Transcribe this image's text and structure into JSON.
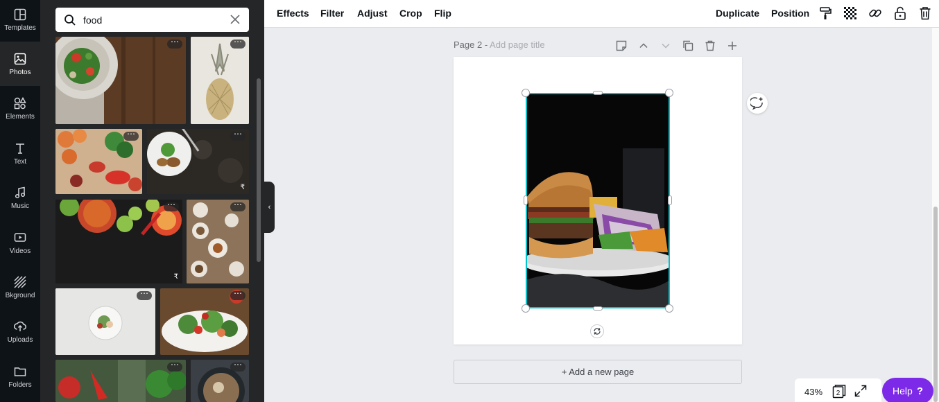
{
  "rail": {
    "items": [
      {
        "label": "Templates",
        "icon": "templates-icon"
      },
      {
        "label": "Photos",
        "icon": "photos-icon",
        "active": true
      },
      {
        "label": "Elements",
        "icon": "elements-icon"
      },
      {
        "label": "Text",
        "icon": "text-icon"
      },
      {
        "label": "Music",
        "icon": "music-icon"
      },
      {
        "label": "Videos",
        "icon": "videos-icon"
      },
      {
        "label": "Bkground",
        "icon": "background-icon"
      },
      {
        "label": "Uploads",
        "icon": "uploads-icon"
      },
      {
        "label": "Folders",
        "icon": "folders-icon"
      }
    ]
  },
  "panel": {
    "search_value": "food",
    "photos": [
      {
        "subject": "salad plate on wooden table"
      },
      {
        "subject": "pineapple"
      },
      {
        "subject": "fruits and vegetables on paper"
      },
      {
        "subject": "plated meal on dark stone",
        "price": "₹"
      },
      {
        "subject": "colorful bowls with limes",
        "price": "₹"
      },
      {
        "subject": "table set with dishes"
      },
      {
        "subject": "small salad on white plate"
      },
      {
        "subject": "thai salad with shrimp"
      },
      {
        "subject": "red peppers and herbs"
      },
      {
        "subject": "dark bowl with food"
      }
    ],
    "more_label": "⋯"
  },
  "toolbar": {
    "effects": "Effects",
    "filter": "Filter",
    "adjust": "Adjust",
    "crop": "Crop",
    "flip": "Flip",
    "duplicate": "Duplicate",
    "position": "Position"
  },
  "canvas": {
    "page_label": "Page 2 - ",
    "page_title_placeholder": "Add page title",
    "add_page": "+ Add a new page"
  },
  "footer": {
    "zoom": "43%",
    "page_count": "2",
    "help": "Help",
    "help_mark": "?"
  },
  "colors": {
    "accent": "#7d2ae8",
    "selection": "#00c4cc",
    "sidebar": "#0e1318",
    "panel": "#252627"
  }
}
